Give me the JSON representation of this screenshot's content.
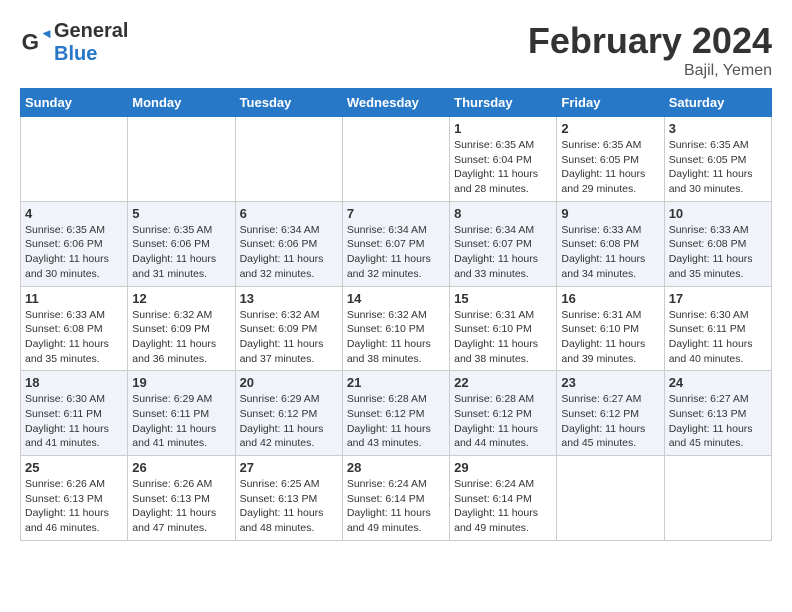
{
  "header": {
    "logo_general": "General",
    "logo_blue": "Blue",
    "month_title": "February 2024",
    "location": "Bajil, Yemen"
  },
  "weekdays": [
    "Sunday",
    "Monday",
    "Tuesday",
    "Wednesday",
    "Thursday",
    "Friday",
    "Saturday"
  ],
  "weeks": [
    [
      {
        "day": "",
        "info": ""
      },
      {
        "day": "",
        "info": ""
      },
      {
        "day": "",
        "info": ""
      },
      {
        "day": "",
        "info": ""
      },
      {
        "day": "1",
        "info": "Sunrise: 6:35 AM\nSunset: 6:04 PM\nDaylight: 11 hours\nand 28 minutes."
      },
      {
        "day": "2",
        "info": "Sunrise: 6:35 AM\nSunset: 6:05 PM\nDaylight: 11 hours\nand 29 minutes."
      },
      {
        "day": "3",
        "info": "Sunrise: 6:35 AM\nSunset: 6:05 PM\nDaylight: 11 hours\nand 30 minutes."
      }
    ],
    [
      {
        "day": "4",
        "info": "Sunrise: 6:35 AM\nSunset: 6:06 PM\nDaylight: 11 hours\nand 30 minutes."
      },
      {
        "day": "5",
        "info": "Sunrise: 6:35 AM\nSunset: 6:06 PM\nDaylight: 11 hours\nand 31 minutes."
      },
      {
        "day": "6",
        "info": "Sunrise: 6:34 AM\nSunset: 6:06 PM\nDaylight: 11 hours\nand 32 minutes."
      },
      {
        "day": "7",
        "info": "Sunrise: 6:34 AM\nSunset: 6:07 PM\nDaylight: 11 hours\nand 32 minutes."
      },
      {
        "day": "8",
        "info": "Sunrise: 6:34 AM\nSunset: 6:07 PM\nDaylight: 11 hours\nand 33 minutes."
      },
      {
        "day": "9",
        "info": "Sunrise: 6:33 AM\nSunset: 6:08 PM\nDaylight: 11 hours\nand 34 minutes."
      },
      {
        "day": "10",
        "info": "Sunrise: 6:33 AM\nSunset: 6:08 PM\nDaylight: 11 hours\nand 35 minutes."
      }
    ],
    [
      {
        "day": "11",
        "info": "Sunrise: 6:33 AM\nSunset: 6:08 PM\nDaylight: 11 hours\nand 35 minutes."
      },
      {
        "day": "12",
        "info": "Sunrise: 6:32 AM\nSunset: 6:09 PM\nDaylight: 11 hours\nand 36 minutes."
      },
      {
        "day": "13",
        "info": "Sunrise: 6:32 AM\nSunset: 6:09 PM\nDaylight: 11 hours\nand 37 minutes."
      },
      {
        "day": "14",
        "info": "Sunrise: 6:32 AM\nSunset: 6:10 PM\nDaylight: 11 hours\nand 38 minutes."
      },
      {
        "day": "15",
        "info": "Sunrise: 6:31 AM\nSunset: 6:10 PM\nDaylight: 11 hours\nand 38 minutes."
      },
      {
        "day": "16",
        "info": "Sunrise: 6:31 AM\nSunset: 6:10 PM\nDaylight: 11 hours\nand 39 minutes."
      },
      {
        "day": "17",
        "info": "Sunrise: 6:30 AM\nSunset: 6:11 PM\nDaylight: 11 hours\nand 40 minutes."
      }
    ],
    [
      {
        "day": "18",
        "info": "Sunrise: 6:30 AM\nSunset: 6:11 PM\nDaylight: 11 hours\nand 41 minutes."
      },
      {
        "day": "19",
        "info": "Sunrise: 6:29 AM\nSunset: 6:11 PM\nDaylight: 11 hours\nand 41 minutes."
      },
      {
        "day": "20",
        "info": "Sunrise: 6:29 AM\nSunset: 6:12 PM\nDaylight: 11 hours\nand 42 minutes."
      },
      {
        "day": "21",
        "info": "Sunrise: 6:28 AM\nSunset: 6:12 PM\nDaylight: 11 hours\nand 43 minutes."
      },
      {
        "day": "22",
        "info": "Sunrise: 6:28 AM\nSunset: 6:12 PM\nDaylight: 11 hours\nand 44 minutes."
      },
      {
        "day": "23",
        "info": "Sunrise: 6:27 AM\nSunset: 6:12 PM\nDaylight: 11 hours\nand 45 minutes."
      },
      {
        "day": "24",
        "info": "Sunrise: 6:27 AM\nSunset: 6:13 PM\nDaylight: 11 hours\nand 45 minutes."
      }
    ],
    [
      {
        "day": "25",
        "info": "Sunrise: 6:26 AM\nSunset: 6:13 PM\nDaylight: 11 hours\nand 46 minutes."
      },
      {
        "day": "26",
        "info": "Sunrise: 6:26 AM\nSunset: 6:13 PM\nDaylight: 11 hours\nand 47 minutes."
      },
      {
        "day": "27",
        "info": "Sunrise: 6:25 AM\nSunset: 6:13 PM\nDaylight: 11 hours\nand 48 minutes."
      },
      {
        "day": "28",
        "info": "Sunrise: 6:24 AM\nSunset: 6:14 PM\nDaylight: 11 hours\nand 49 minutes."
      },
      {
        "day": "29",
        "info": "Sunrise: 6:24 AM\nSunset: 6:14 PM\nDaylight: 11 hours\nand 49 minutes."
      },
      {
        "day": "",
        "info": ""
      },
      {
        "day": "",
        "info": ""
      }
    ]
  ]
}
